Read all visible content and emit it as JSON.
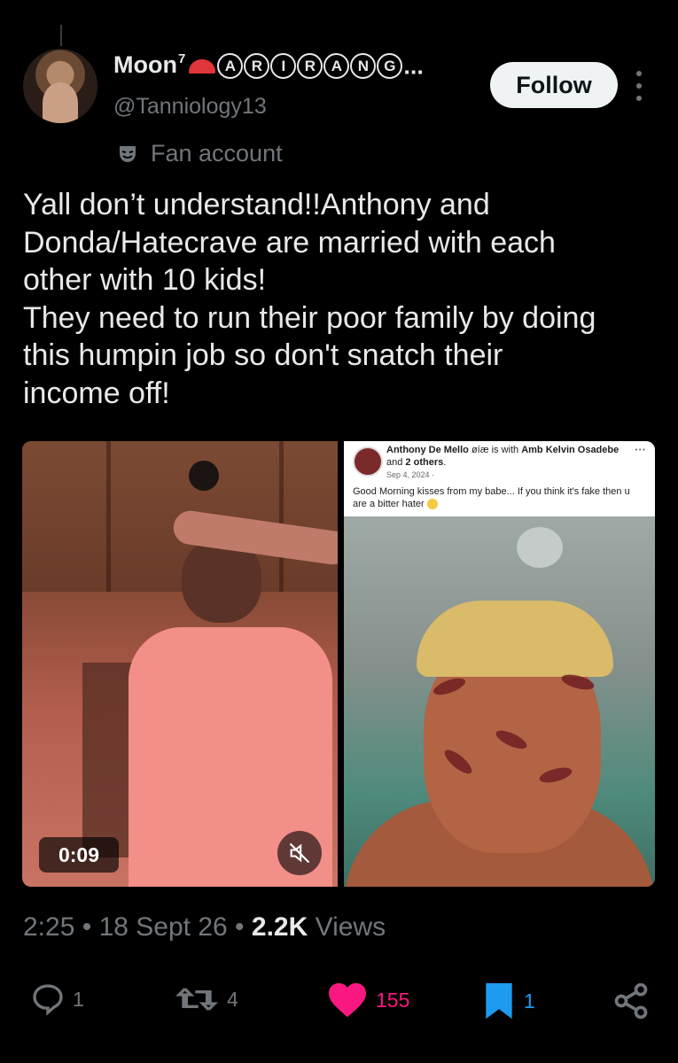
{
  "author": {
    "display_name": "Moon",
    "display_name_sup": "7",
    "name_letters": [
      "A",
      "R",
      "I",
      "R",
      "A",
      "N",
      "G"
    ],
    "name_suffix": "...",
    "handle": "@Tanniology13",
    "fan_label": "Fan account"
  },
  "follow_label": "Follow",
  "tweet_text": "Yall don’t understand!!Anthony and\nDonda/Hatecrave are married with each\nother with 10 kids!\nThey need to run their poor family by doing\nthis humpin job so don't snatch their\nincome off!",
  "media": {
    "video_timer": "0:09",
    "fb_post": {
      "author": "Anthony De Mello",
      "author_suffix": " øíæ",
      "with_text": " is with ",
      "with_person": "Amb Kelvin Osadebe",
      "and_text": " and ",
      "others": "2 others",
      "end": ".",
      "date": "Sep 4, 2024 ·",
      "dots": "···",
      "text": "Good Morning kisses from my babe... If you think it's fake then u are a bitter hater"
    }
  },
  "meta": {
    "time": "2:25",
    "sep": " • ",
    "date": "18 Sept 26",
    "views_count": "2.2K",
    "views_label": " Views"
  },
  "actions": {
    "replies": "1",
    "reposts": "4",
    "likes": "155",
    "bookmarks": "1"
  },
  "colors": {
    "like": "#f91880",
    "bookmark": "#1d9bf0",
    "muted": "#71767b",
    "text": "#e7e9ea"
  }
}
